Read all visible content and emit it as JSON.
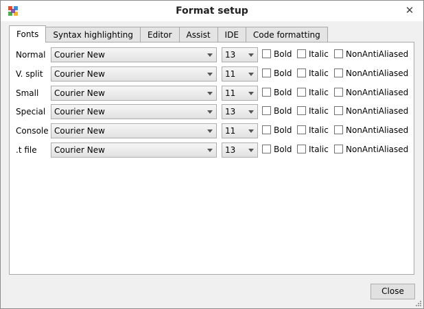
{
  "window": {
    "title": "Format setup",
    "close_glyph": "✕"
  },
  "tabs": [
    {
      "label": "Fonts",
      "active": true
    },
    {
      "label": "Syntax highlighting",
      "active": false
    },
    {
      "label": "Editor",
      "active": false
    },
    {
      "label": "Assist",
      "active": false
    },
    {
      "label": "IDE",
      "active": false
    },
    {
      "label": "Code formatting",
      "active": false
    }
  ],
  "checkbox_labels": {
    "bold": "Bold",
    "italic": "Italic",
    "nonantialiased": "NonAntiAliased"
  },
  "rows": [
    {
      "label": "Normal",
      "font": "Courier New",
      "size": "13",
      "bold": false,
      "italic": false,
      "nonantialiased": false
    },
    {
      "label": "V. split",
      "font": "Courier New",
      "size": "11",
      "bold": false,
      "italic": false,
      "nonantialiased": false
    },
    {
      "label": "Small",
      "font": "Courier New",
      "size": "11",
      "bold": false,
      "italic": false,
      "nonantialiased": false
    },
    {
      "label": "Special",
      "font": "Courier New",
      "size": "13",
      "bold": false,
      "italic": false,
      "nonantialiased": false
    },
    {
      "label": "Console",
      "font": "Courier New",
      "size": "11",
      "bold": false,
      "italic": false,
      "nonantialiased": false
    },
    {
      "label": ".t file",
      "font": "Courier New",
      "size": "13",
      "bold": false,
      "italic": false,
      "nonantialiased": false
    }
  ],
  "footer": {
    "close_label": "Close"
  },
  "icons": {
    "app": "app-icon",
    "close": "close-icon",
    "dropdown": "chevron-down-icon"
  }
}
